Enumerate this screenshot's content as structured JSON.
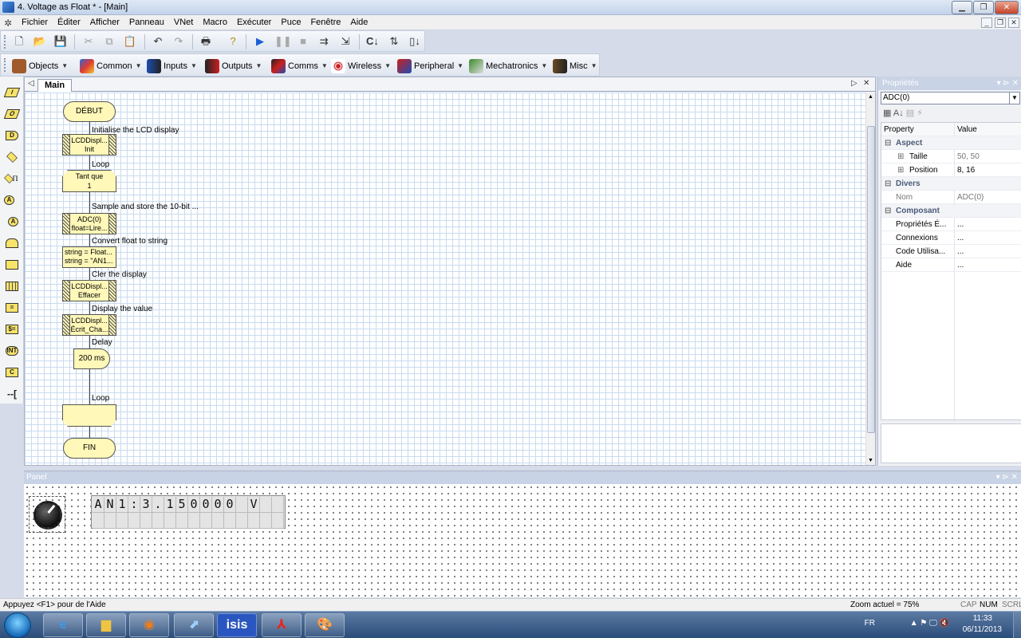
{
  "window": {
    "title": "4. Voltage as Float * - [Main]"
  },
  "menu": [
    "Fichier",
    "Éditer",
    "Afficher",
    "Panneau",
    "VNet",
    "Macro",
    "Exécuter",
    "Puce",
    "Fenêtre",
    "Aide"
  ],
  "toolbar2": [
    "Objects",
    "Common",
    "Inputs",
    "Outputs",
    "Comms",
    "Wireless",
    "Peripheral",
    "Mechatronics",
    "Misc"
  ],
  "doc": {
    "tab": "Main"
  },
  "flowchart": {
    "start": "DÉBUT",
    "end": "FIN",
    "c_init": "Initialise the LCD display",
    "m_init_1": "LCDDispl...",
    "m_init_2": "Init",
    "c_loop": "Loop",
    "while_1": "Tant que",
    "while_2": "1",
    "c_sample": "Sample and store the 10-bit ...",
    "adc_1": "ADC(0)",
    "adc_2": "float=Lire...",
    "c_convert": "Convert float to string",
    "calc_1": "string = Float...",
    "calc_2": "string = \"AN1...",
    "c_clear": "Cler the display",
    "clr_1": "LCDDispl...",
    "clr_2": "Effacer",
    "c_display": "Display the value",
    "disp_1": "LCDDispl...",
    "disp_2": "Écrit_Cha...",
    "c_delay": "Delay",
    "delay": "200 ms",
    "c_loopend": "Loop"
  },
  "properties": {
    "title": "Propriétés",
    "selected": "ADC(0)",
    "col_property": "Property",
    "col_value": "Value",
    "cat_aspect": "Aspect",
    "taille": "Taille",
    "taille_v": "50, 50",
    "position": "Position",
    "position_v": "8, 16",
    "cat_divers": "Divers",
    "nom": "Nom",
    "nom_v": "ADC(0)",
    "cat_composant": "Composant",
    "p1": "Propriétés É...",
    "p1_v": "...",
    "p2": "Connexions",
    "p2_v": "...",
    "p3": "Code Utilisa...",
    "p3_v": "...",
    "p4": "Aide",
    "p4_v": "..."
  },
  "panel": {
    "title": "Panel",
    "lcd_line1": "AN1:3.150000 V",
    "lcd_line2": ""
  },
  "status": {
    "help": "Appuyez <F1> pour de l'Aide",
    "zoom": "Zoom actuel = 75%",
    "cap": "CAP",
    "num": "NUM",
    "scrl": "SCRL"
  },
  "taskbar": {
    "lang": "FR",
    "time": "11:33",
    "date": "06/11/2013",
    "isis": "isis"
  }
}
